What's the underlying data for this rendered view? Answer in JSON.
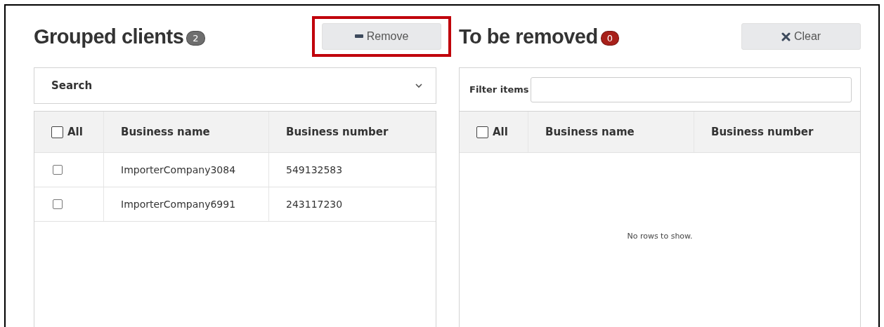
{
  "grouped_clients": {
    "title": "Grouped clients",
    "count": {
      "text": "2",
      "color": "#6e6e6e"
    },
    "remove_button": {
      "label": "Remove",
      "highlighted": true
    },
    "search": {
      "label": "Search",
      "expanded": false
    },
    "table": {
      "select_all": {
        "label": "All",
        "checked": false
      },
      "columns": [
        "Business name",
        "Business number"
      ],
      "rows": [
        {
          "checked": false,
          "cells": [
            "ImporterCompany3084",
            "549132583"
          ]
        },
        {
          "checked": false,
          "cells": [
            "ImporterCompany6991",
            "243117230"
          ]
        }
      ]
    }
  },
  "to_be_removed": {
    "title": "To be removed",
    "count": {
      "text": "0",
      "color": "#a8201a"
    },
    "clear_button": {
      "label": "Clear"
    },
    "filter": {
      "label": "Filter items"
    },
    "table": {
      "select_all": {
        "label": "All",
        "checked": false
      },
      "columns": [
        "Business name",
        "Business number"
      ],
      "empty_message": "No rows to show."
    }
  }
}
